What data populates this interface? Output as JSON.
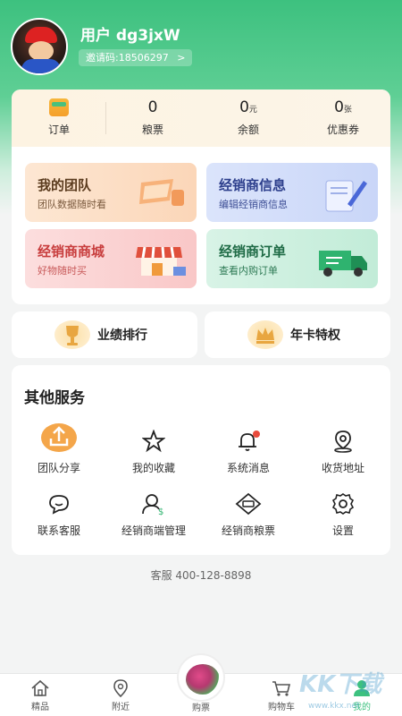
{
  "profile": {
    "username": "用户 dg3jxW",
    "invite_code": "邀请码:18506297",
    "invite_arrow": ">"
  },
  "stats": [
    {
      "label": "订单",
      "icon": "order-icon"
    },
    {
      "label": "粮票",
      "value": "0",
      "unit": ""
    },
    {
      "label": "余额",
      "value": "0",
      "unit": "元"
    },
    {
      "label": "优惠券",
      "value": "0",
      "unit": "张"
    }
  ],
  "tiles": [
    {
      "title": "我的团队",
      "subtitle": "团队数据随时看"
    },
    {
      "title": "经销商信息",
      "subtitle": "编辑经销商信息"
    },
    {
      "title": "经销商商城",
      "subtitle": "好物随时买"
    },
    {
      "title": "经销商订单",
      "subtitle": "查看内购订单"
    }
  ],
  "bars": [
    {
      "label": "业绩排行",
      "icon": "trophy-icon"
    },
    {
      "label": "年卡特权",
      "icon": "crown-icon"
    }
  ],
  "services": {
    "title": "其他服务",
    "items": [
      {
        "label": "团队分享",
        "icon": "share-icon"
      },
      {
        "label": "我的收藏",
        "icon": "star-icon"
      },
      {
        "label": "系统消息",
        "icon": "bell-icon"
      },
      {
        "label": "收货地址",
        "icon": "location-icon"
      },
      {
        "label": "联系客服",
        "icon": "chat-icon"
      },
      {
        "label": "经销商端管理",
        "icon": "user-manage-icon"
      },
      {
        "label": "经销商粮票",
        "icon": "ticket-icon"
      },
      {
        "label": "设置",
        "icon": "gear-icon"
      }
    ]
  },
  "hotline": "客服 400-128-8898",
  "tabbar": [
    {
      "label": "精品",
      "icon": "home-icon"
    },
    {
      "label": "附近",
      "icon": "map-pin-icon"
    },
    {
      "label": "购票",
      "icon": "ticket-flower-icon"
    },
    {
      "label": "购物车",
      "icon": "cart-icon"
    },
    {
      "label": "我的",
      "icon": "profile-icon"
    }
  ],
  "colors": {
    "brand": "#3dc17f",
    "accent_orange": "#f59f2a",
    "badge_red": "#e84a3c"
  },
  "watermark": {
    "logo": "KK下载",
    "url": "www.kkx.net"
  }
}
